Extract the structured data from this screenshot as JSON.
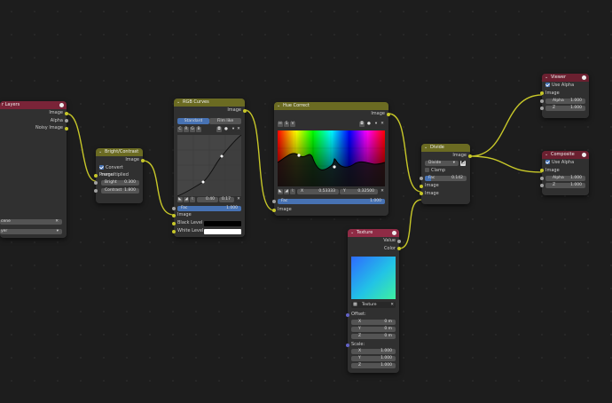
{
  "colors": {
    "color_header": "#7a2438",
    "converter_header": "#6b6b22",
    "texture_header": "#8f2b45",
    "output_header": "#6b2030",
    "socket_color": "#c7c729",
    "socket_value": "#a1a1a1",
    "socket_vector": "#6363c7",
    "accent": "#4772b3"
  },
  "render_layers": {
    "title": "r Layers",
    "out1": "Image",
    "out2": "Alpha",
    "out3": "Noisy Image",
    "scene": "cene",
    "layer": "yer"
  },
  "bright_contrast": {
    "title": "Bright/Contrast",
    "out": "Image",
    "convert": "Convert Premultiplied",
    "in_image": "Image",
    "bright_label": "Bright",
    "bright_value": "0.300",
    "contrast_label": "Contrast",
    "contrast_value": "1.800"
  },
  "rgb_curves": {
    "title": "RGB Curves",
    "out": "Image",
    "tab1": "Standard",
    "tab2": "Film like",
    "c": "C",
    "r": "R",
    "g": "G",
    "b": "B",
    "val1": "0.40",
    "val2": "0.17",
    "fac_label": "Fac",
    "fac_value": "1.000",
    "in_image": "Image",
    "black_level": "Black Level",
    "white_level": "White Level"
  },
  "hue_correct": {
    "title": "Hue Correct",
    "out": "Image",
    "h": "H",
    "s": "S",
    "v": "V",
    "x_label": "X",
    "x_value": "0.53333",
    "y_label": "Y",
    "y_value": "0.32500",
    "fac_label": "Fac",
    "fac_value": "1.000",
    "in_image": "Image"
  },
  "divide": {
    "title": "Divide",
    "out": "Image",
    "mode": "Divide",
    "clamp": "Clamp",
    "fac_label": "Fac",
    "fac_value": "0.142",
    "in1": "Image",
    "in2": "Image"
  },
  "texture": {
    "title": "Texture",
    "out1": "Value",
    "out2": "Color",
    "texture_name": "Texture",
    "offset_label": "Offset:",
    "ox_label": "X",
    "ox_value": "0 m",
    "oy_label": "Y",
    "oy_value": "0 m",
    "oz_label": "Z",
    "oz_value": "0 m",
    "scale_label": "Scale:",
    "sx_label": "X",
    "sx_value": "1.000",
    "sy_label": "Y",
    "sy_value": "1.000",
    "sz_label": "Z",
    "sz_value": "1.000"
  },
  "viewer": {
    "title": "Viewer",
    "use_alpha": "Use Alpha",
    "in_image": "Image",
    "alpha_label": "Alpha",
    "alpha_value": "1.000",
    "z_label": "Z",
    "z_value": "1.000"
  },
  "composite": {
    "title": "Composite",
    "use_alpha": "Use Alpha",
    "in_image": "Image",
    "alpha_label": "Alpha",
    "alpha_value": "1.000",
    "z_label": "Z",
    "z_value": "1.000"
  }
}
